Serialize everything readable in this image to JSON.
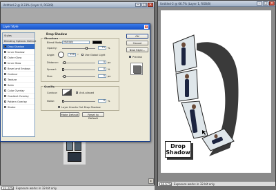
{
  "doc_left": {
    "title": "Untitled-2 @ 8.33% (Layer 0, RGB/8)",
    "zoom": "8.33%"
  },
  "doc_right": {
    "title": "Untitled-2 @ 66.7% (Layer 1, RGB/8)",
    "zoom": "66.67%",
    "status": "Exposure works in 32-bit only",
    "label_line1": "Drop",
    "label_line2": "Shadow"
  },
  "bottom_left": {
    "zoom": "33.33%",
    "status": "Exposure works in 32-bit only"
  },
  "dialog": {
    "title": "Layer Style",
    "styles_header": "Styles",
    "blending_options": "Blending Options: Default",
    "styles": [
      {
        "label": "Drop Shadow",
        "checked": true,
        "selected": true
      },
      {
        "label": "Inner Shadow",
        "checked": false,
        "selected": false
      },
      {
        "label": "Outer Glow",
        "checked": false,
        "selected": false
      },
      {
        "label": "Inner Glow",
        "checked": false,
        "selected": false
      },
      {
        "label": "Bevel and Emboss",
        "checked": false,
        "selected": false
      },
      {
        "label": "Contour",
        "checked": false,
        "selected": false
      },
      {
        "label": "Texture",
        "checked": false,
        "selected": false
      },
      {
        "label": "Satin",
        "checked": false,
        "selected": false
      },
      {
        "label": "Color Overlay",
        "checked": false,
        "selected": false
      },
      {
        "label": "Gradient Overlay",
        "checked": false,
        "selected": false
      },
      {
        "label": "Pattern Overlay",
        "checked": false,
        "selected": false
      },
      {
        "label": "Stroke",
        "checked": false,
        "selected": false
      }
    ],
    "section_title": "Drop Shadow",
    "structure": {
      "label": "Structure",
      "blend_mode_label": "Blend Mode:",
      "blend_mode_value": "Multiply",
      "opacity_label": "Opacity:",
      "opacity_value": "75",
      "angle_label": "Angle:",
      "angle_value": "120",
      "global_light_label": "Use Global Light",
      "distance_label": "Distance:",
      "distance_value": "5",
      "spread_label": "Spread:",
      "spread_value": "0",
      "size_label": "Size:",
      "size_value": "5",
      "unit_px": "px",
      "unit_pct": "%",
      "unit_deg": "°"
    },
    "quality": {
      "label": "Quality",
      "contour_label": "Contour:",
      "anti_aliased_label": "Anti-aliased",
      "noise_label": "Noise:",
      "noise_value": "0",
      "knocks_out_label": "Layer Knocks Out Drop Shadow",
      "make_default": "Make Default",
      "reset_default": "Reset to Default"
    },
    "buttons": {
      "ok": "OK",
      "cancel": "Cancel",
      "new_style": "New Style...",
      "preview": "Preview"
    },
    "colors": {
      "shadow_color": "#000000",
      "selection": "#316ac5"
    }
  }
}
